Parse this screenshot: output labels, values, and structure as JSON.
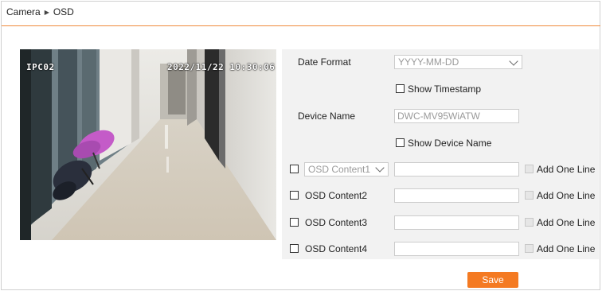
{
  "breadcrumb": {
    "parent": "Camera",
    "separator": "▶",
    "current": "OSD"
  },
  "preview": {
    "channel_text": "IPC02",
    "timestamp_text": "2022/11/22 10:30:06"
  },
  "osd": {
    "date_format": {
      "label": "Date Format",
      "value": "YYYY-MM-DD"
    },
    "show_timestamp": {
      "label": "Show Timestamp",
      "checked": false
    },
    "device_name": {
      "label": "Device Name",
      "value": "DWC-MV95WiATW"
    },
    "show_device_name": {
      "label": "Show Device Name",
      "checked": false
    },
    "content_rows": [
      {
        "label": "OSD Content1",
        "checked": false,
        "is_select": true,
        "text": "",
        "add_one_line_label": "Add One Line",
        "add_one_line_checked": false
      },
      {
        "label": "OSD Content2",
        "checked": false,
        "is_select": false,
        "text": "",
        "add_one_line_label": "Add One Line",
        "add_one_line_checked": false
      },
      {
        "label": "OSD Content3",
        "checked": false,
        "is_select": false,
        "text": "",
        "add_one_line_label": "Add One Line",
        "add_one_line_checked": false
      },
      {
        "label": "OSD Content4",
        "checked": false,
        "is_select": false,
        "text": "",
        "add_one_line_label": "Add One Line",
        "add_one_line_checked": false
      }
    ]
  },
  "save_label": "Save",
  "colors": {
    "accent": "#f47a22",
    "divider": "#f08a3c",
    "panel_bg": "#f2f2f2"
  },
  "icons": {
    "dropdown": "chevron-down-icon",
    "breadcrumb_separator": "triangle-right-icon"
  }
}
